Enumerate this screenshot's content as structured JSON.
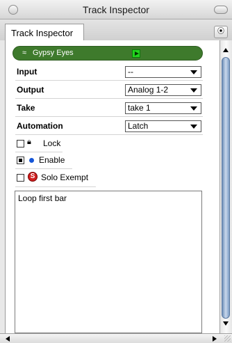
{
  "window": {
    "title": "Track Inspector"
  },
  "tab": {
    "label": "Track Inspector",
    "menu_icon": "circle-triangle-icon"
  },
  "track": {
    "name": "Gypsy Eyes",
    "wave_glyph": "≈",
    "color": "#3e7a2c",
    "play_color": "#22d31e"
  },
  "fields": [
    {
      "label": "Input",
      "value": "--"
    },
    {
      "label": "Output",
      "value": "Analog 1-2"
    },
    {
      "label": "Take",
      "value": "take 1"
    },
    {
      "label": "Automation",
      "value": "Latch"
    }
  ],
  "options": [
    {
      "label": "Lock",
      "checked": false,
      "icon": "lock-icon"
    },
    {
      "label": "Enable",
      "checked": true,
      "icon": "blue-dot-icon"
    },
    {
      "label": "Solo Exempt",
      "checked": false,
      "icon": "solo-icon",
      "icon_text": "S"
    }
  ],
  "notes": {
    "text": "Loop first bar"
  }
}
